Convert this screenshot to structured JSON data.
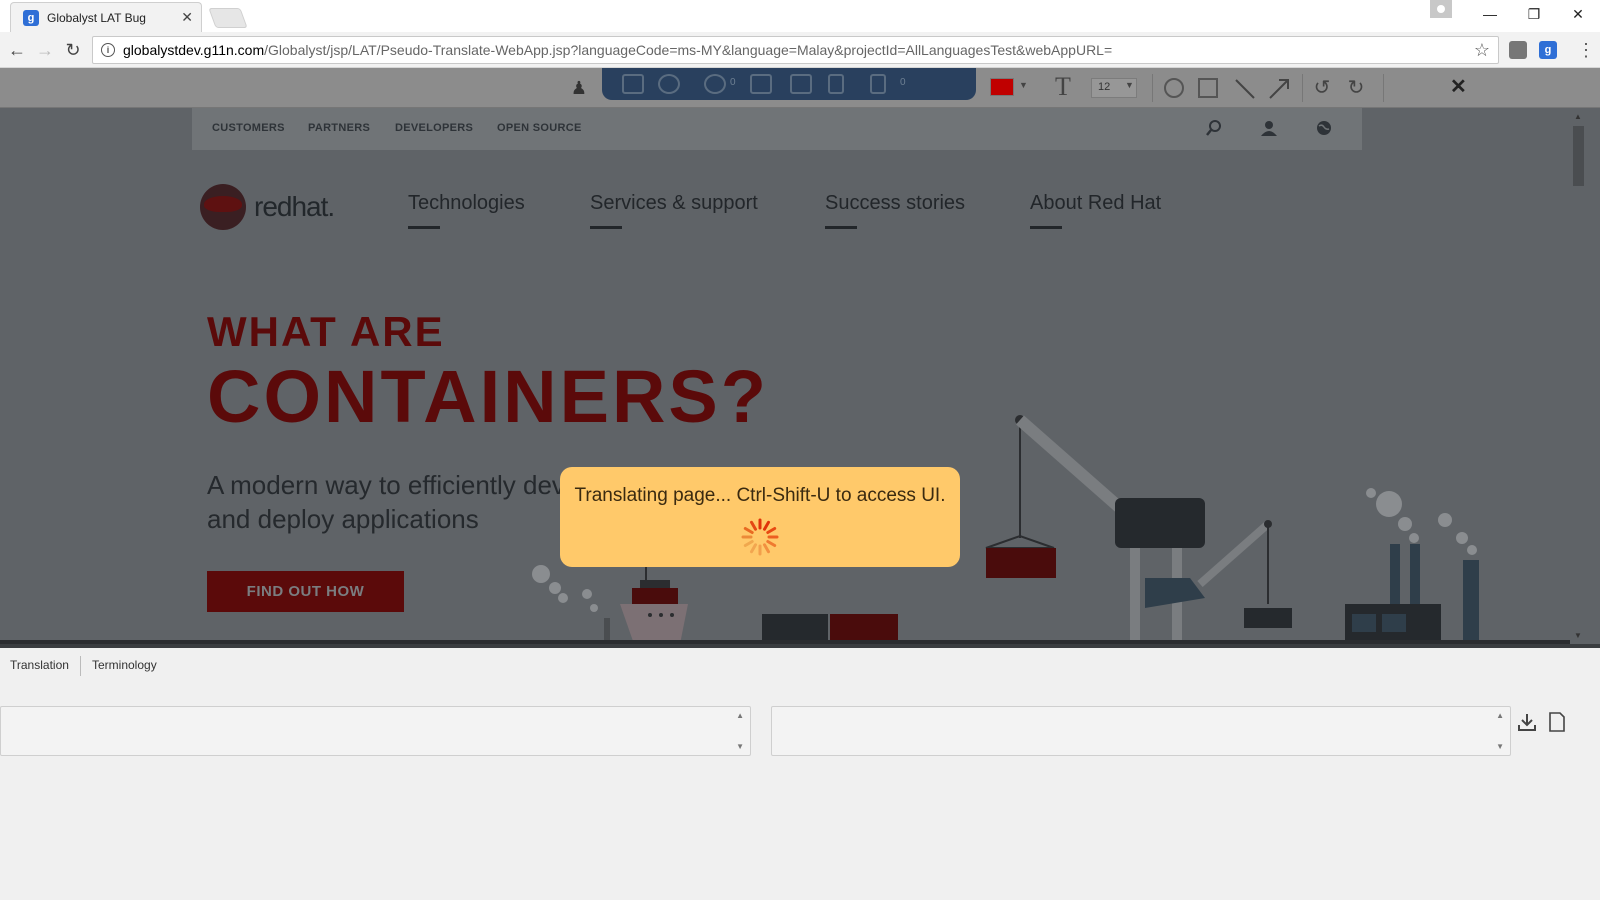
{
  "browser": {
    "tab_title": "Globalyst LAT Bug",
    "tab_close": "✕",
    "favicon_letter": "g",
    "url_host": "globalystdev.g11n.com",
    "url_path": "/Globalyst/jsp/LAT/Pseudo-Translate-WebApp.jsp?languageCode=ms-MY&language=Malay&projectId=AllLanguagesTest&webAppURL="
  },
  "lat_toolbar": {
    "counts": [
      "0",
      "0"
    ],
    "font_size": "12",
    "selected_color": "#c00000"
  },
  "site": {
    "utility_links": [
      "CUSTOMERS",
      "PARTNERS",
      "DEVELOPERS",
      "OPEN SOURCE"
    ],
    "logo_bold": "red",
    "logo_rest": "hat.",
    "nav": [
      "Technologies",
      "Services & support",
      "Success stories",
      "About Red Hat"
    ],
    "hero": {
      "eyebrow": "WHAT ARE",
      "title": "CONTAINERS?",
      "subtitle": "A modern way to efficiently develop and deploy applications",
      "cta": "FIND OUT HOW"
    }
  },
  "overlay": {
    "message": "Translating page... Ctrl-Shift-U to access UI."
  },
  "bottom_panel": {
    "tabs": [
      "Translation",
      "Terminology"
    ]
  },
  "colors": {
    "brand_red_dimmed": "#5b0a0a",
    "overlay_bg": "#ffc96a",
    "lat_panel": "#29405e"
  }
}
